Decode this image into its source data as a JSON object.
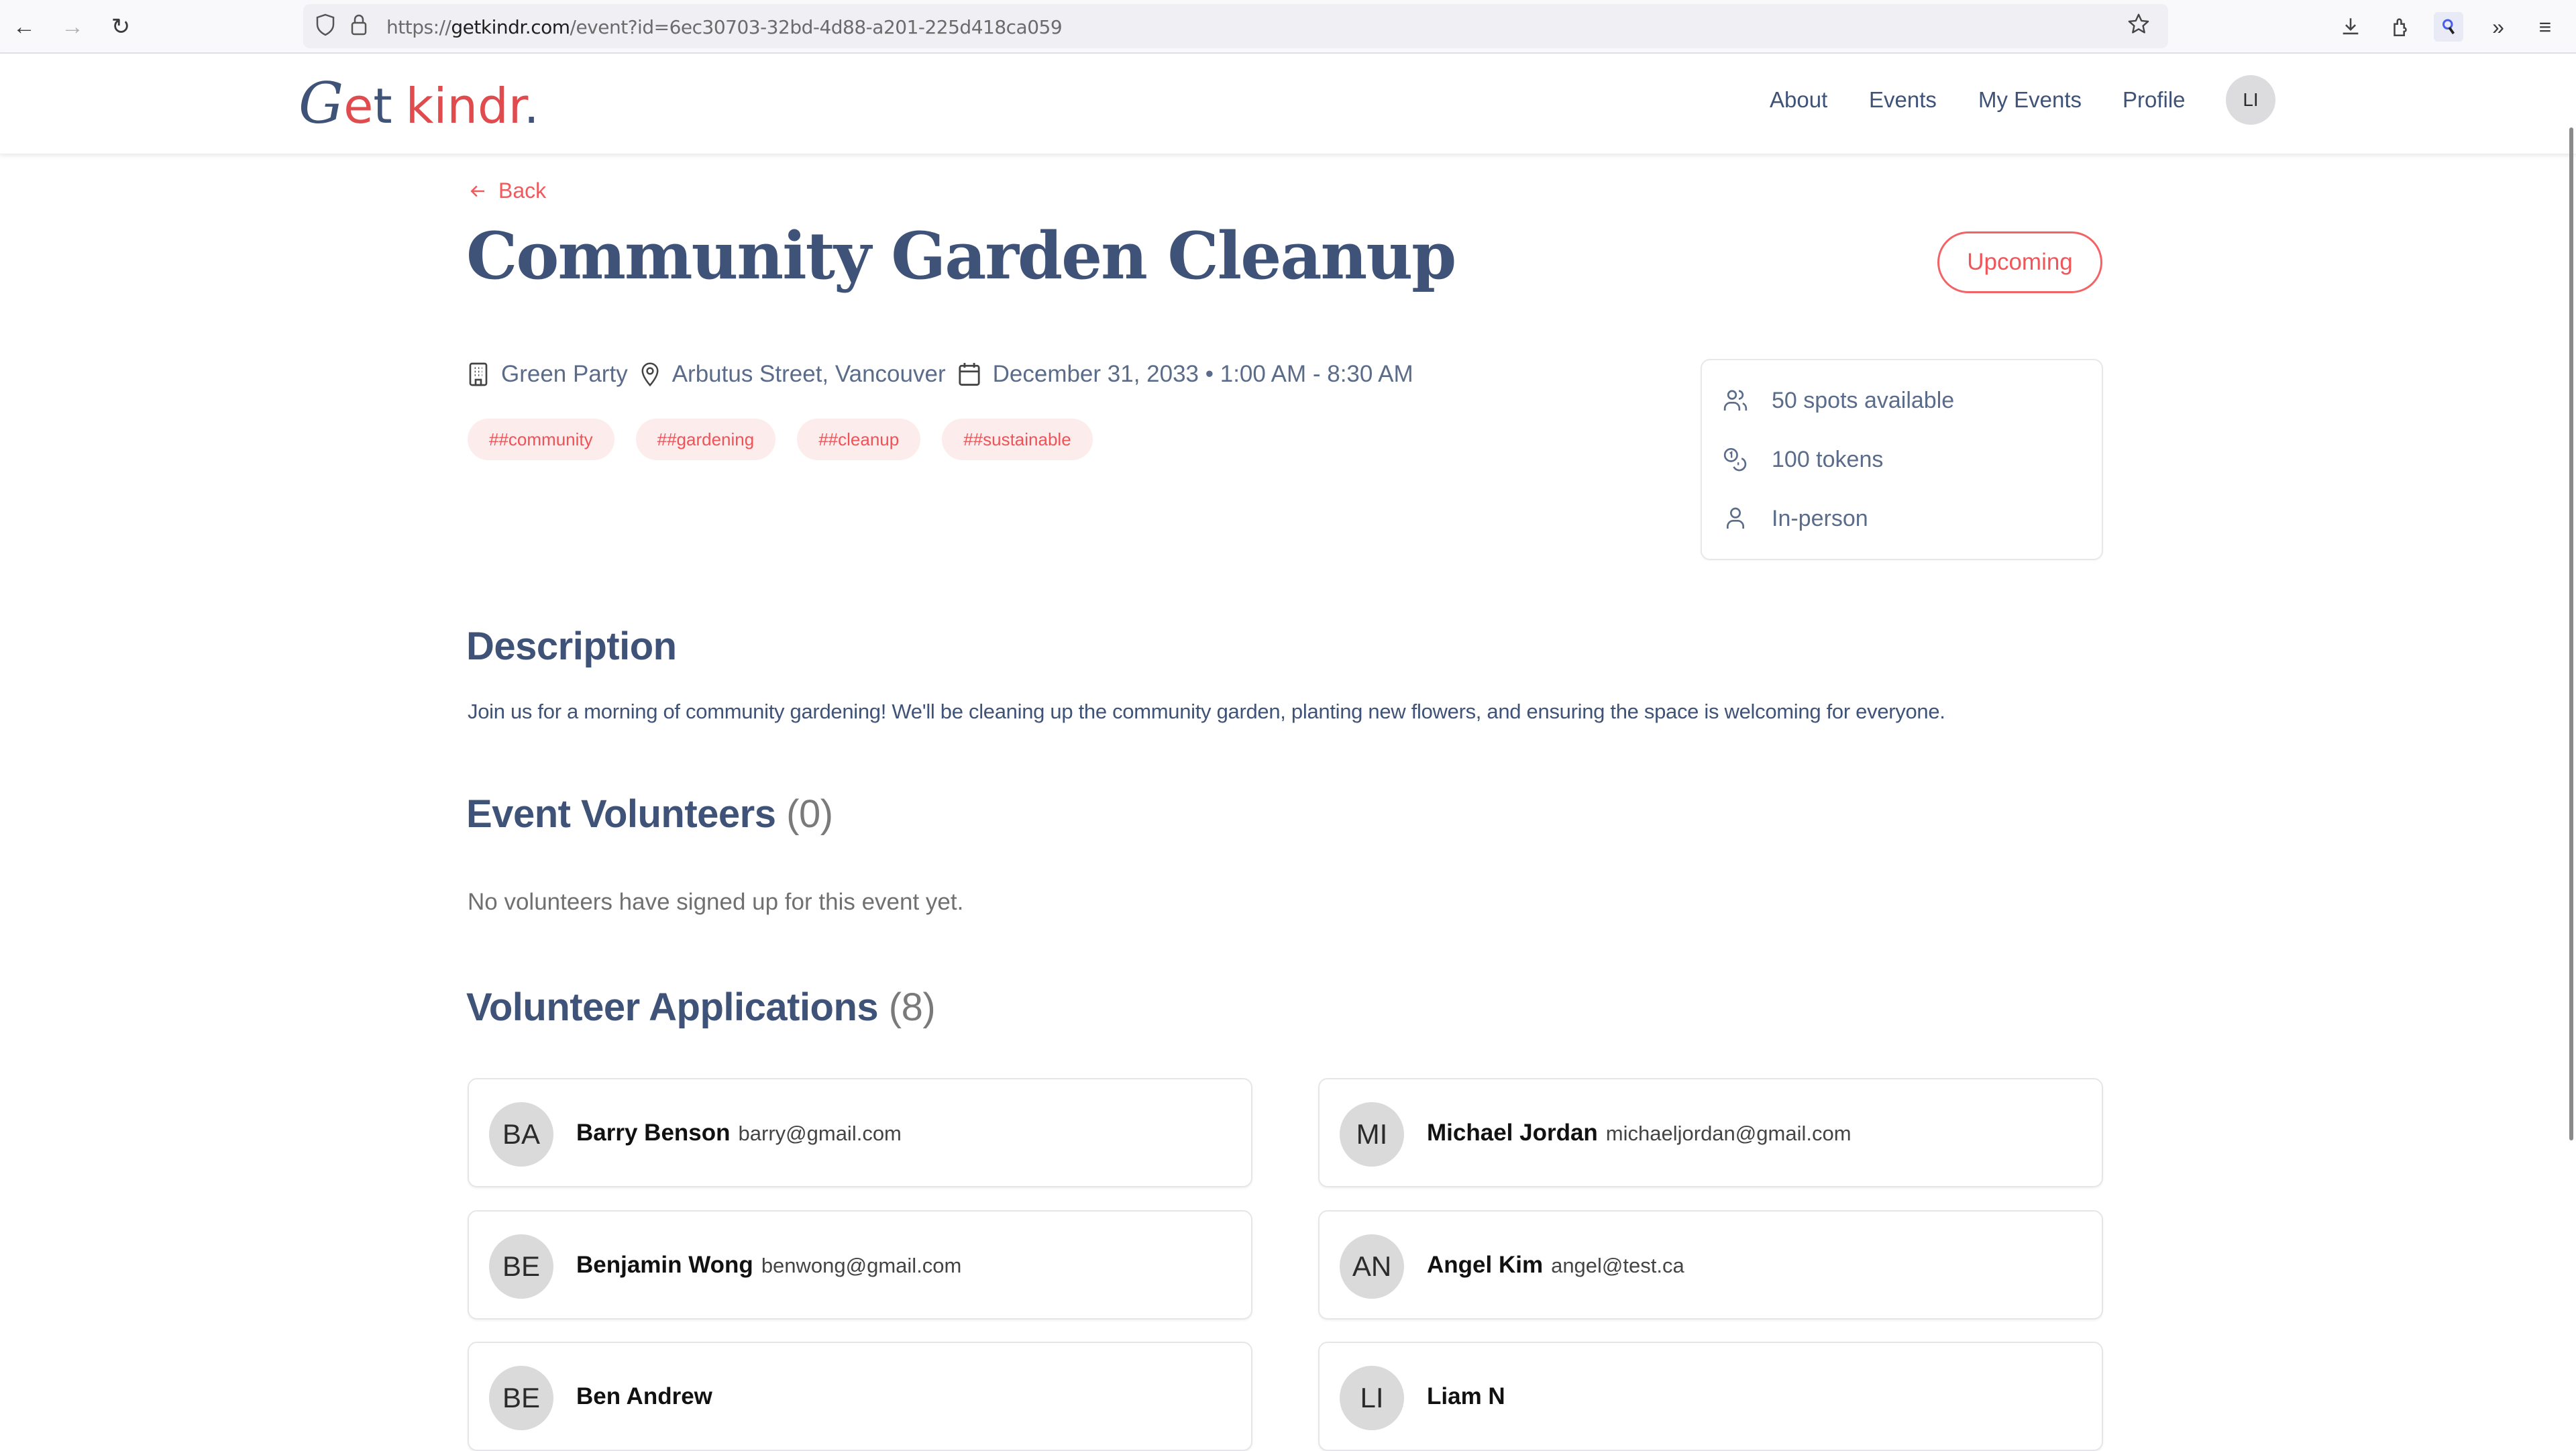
{
  "browser": {
    "url_prefix": "https://",
    "url_domain": "getkindr.com",
    "url_path": "/event?id=6ec30703-32bd-4d88-a201-225d418ca059"
  },
  "header": {
    "logo": {
      "g": "G",
      "e": "e",
      "t": "t",
      "ki": "ki",
      "ndr": "ndr",
      "dot": "."
    },
    "nav": [
      {
        "label": "About"
      },
      {
        "label": "Events"
      },
      {
        "label": "My Events"
      },
      {
        "label": "Profile"
      }
    ],
    "user_initials": "LI"
  },
  "event": {
    "back_label": "Back",
    "title": "Community Garden Cleanup",
    "status": "Upcoming",
    "organization": "Green Party",
    "location": "Arbutus Street, Vancouver",
    "datetime": "December 31, 2033 • 1:00 AM - 8:30 AM",
    "tags": [
      "##community",
      "##gardening",
      "##cleanup",
      "##sustainable"
    ],
    "info": {
      "spots": "50 spots available",
      "tokens": "100 tokens",
      "mode": "In-person"
    }
  },
  "description": {
    "heading": "Description",
    "text": "Join us for a morning of community gardening! We'll be cleaning up the community garden, planting new flowers, and ensuring the space is welcoming for everyone."
  },
  "volunteers": {
    "heading": "Event Volunteers",
    "count": "(0)",
    "empty_text": "No volunteers have signed up for this event yet."
  },
  "applications": {
    "heading": "Volunteer Applications",
    "count": "(8)",
    "items": [
      {
        "initials": "BA",
        "name": "Barry Benson",
        "email": "barry@gmail.com"
      },
      {
        "initials": "MI",
        "name": "Michael Jordan",
        "email": "michaeljordan@gmail.com"
      },
      {
        "initials": "BE",
        "name": "Benjamin Wong",
        "email": "benwong@gmail.com"
      },
      {
        "initials": "AN",
        "name": "Angel Kim",
        "email": "angel@test.ca"
      },
      {
        "initials": "BE",
        "name": "Ben Andrew",
        "email": ""
      },
      {
        "initials": "LI",
        "name": "Liam N",
        "email": ""
      }
    ]
  },
  "colors": {
    "brand_navy": "#3f5277",
    "brand_red": "#e04b4e",
    "accent_coral": "#f0555a",
    "tag_bg": "#fdecec"
  }
}
